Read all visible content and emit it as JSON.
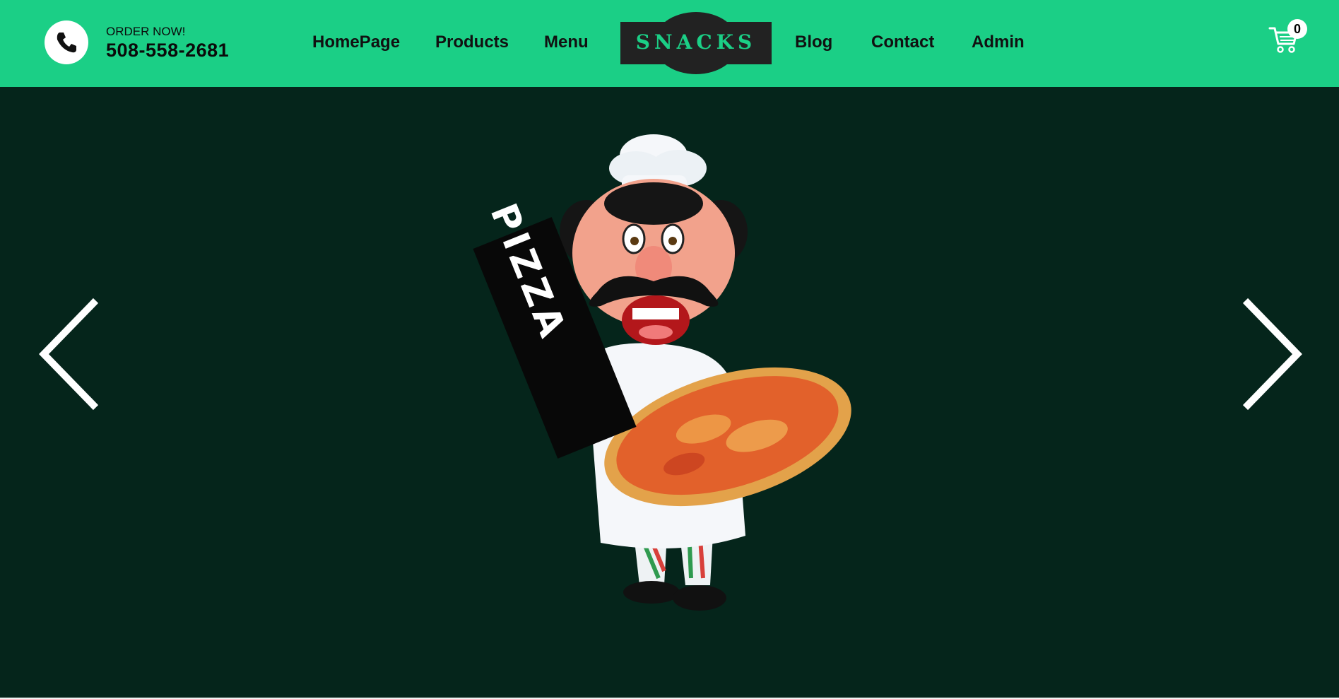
{
  "header": {
    "order_label": "ORDER NOW!",
    "phone_number": "508-558-2681",
    "icon": "phone-icon",
    "nav": [
      {
        "label": "HomePage"
      },
      {
        "label": "Products"
      },
      {
        "label": "Menu"
      },
      {
        "label": "Blog"
      },
      {
        "label": "Contact"
      },
      {
        "label": "Admin"
      }
    ],
    "logo_text": "SNACKS",
    "cart": {
      "icon": "cart-icon",
      "count": "0"
    }
  },
  "slider": {
    "sign_text": "PIZZA",
    "prev_icon": "chevron-left-icon",
    "next_icon": "chevron-right-icon"
  },
  "colors": {
    "header_bg": "#1bcf86",
    "slider_bg": "#05251b",
    "logo_bg": "#222222",
    "logo_text": "#1bcf86"
  }
}
